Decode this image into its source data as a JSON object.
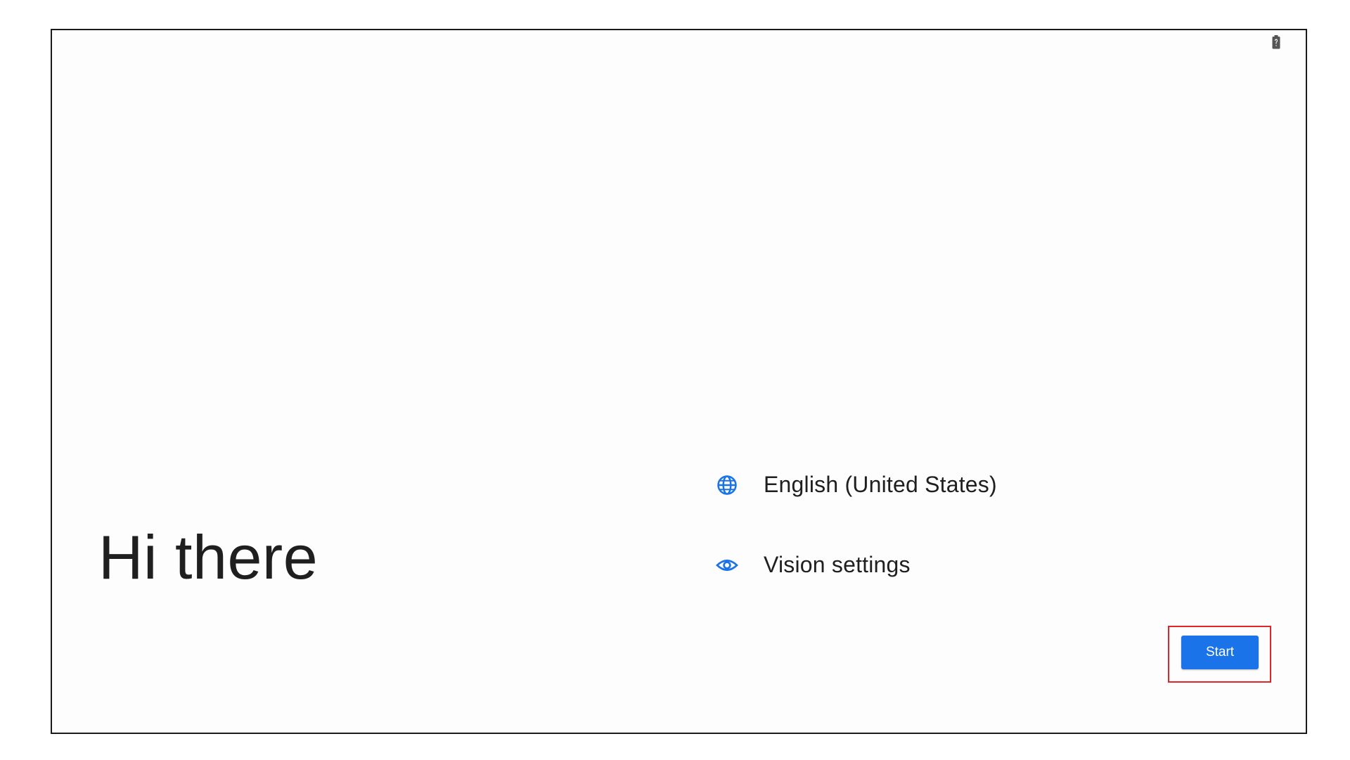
{
  "greeting": "Hi there",
  "options": {
    "language": {
      "label": "English (United States)",
      "icon": "globe-icon"
    },
    "vision": {
      "label": "Vision settings",
      "icon": "eye-icon"
    }
  },
  "start_button": {
    "label": "Start"
  },
  "status_bar": {
    "battery_icon": "battery-unknown-icon"
  },
  "colors": {
    "accent": "#1a73e8",
    "highlight": "#e0262b",
    "text": "#1f1f1f"
  }
}
